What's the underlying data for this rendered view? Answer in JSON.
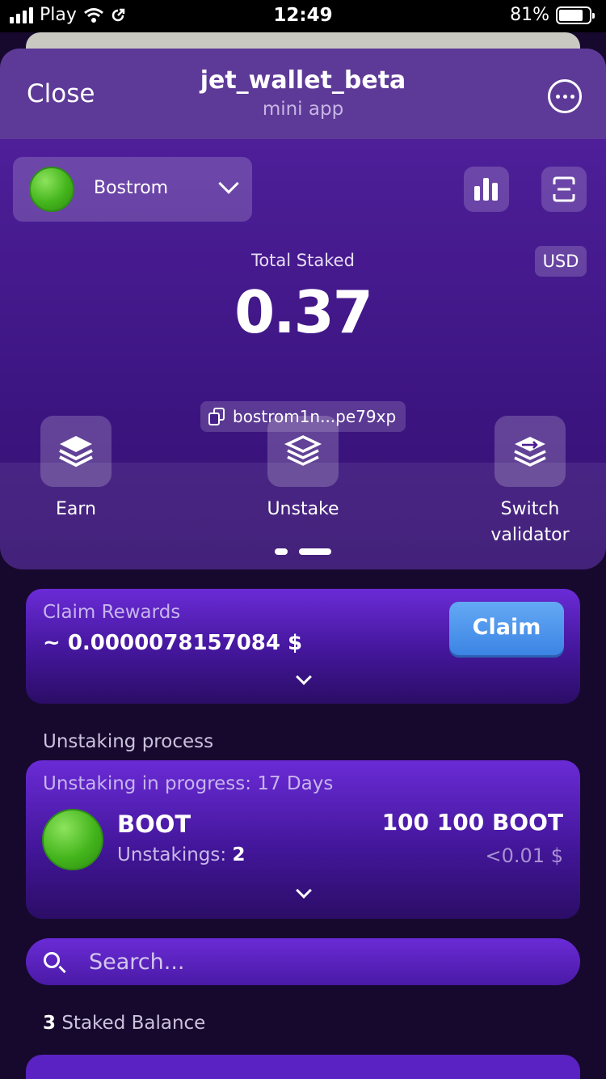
{
  "status_bar": {
    "carrier": "Play",
    "time": "12:49",
    "battery": "81%"
  },
  "header": {
    "close_label": "Close",
    "title": "jet_wallet_beta",
    "subtitle": "mini app"
  },
  "network": {
    "name": "Bostrom"
  },
  "balance": {
    "total_label": "Total Staked",
    "total_value": "0.37",
    "currency": "USD",
    "address": "bostrom1n...pe79xp"
  },
  "actions": [
    {
      "label": "Earn",
      "icon": "layers-icon"
    },
    {
      "label": "Unstake",
      "icon": "layers-outline-icon"
    },
    {
      "label": "Switch validator",
      "icon": "switch-layers-icon"
    }
  ],
  "claim": {
    "title": "Claim Rewards",
    "value": "~ 0.0000078157084 $",
    "button_label": "Claim"
  },
  "unstaking": {
    "section_label": "Unstaking process",
    "title": "Unstaking in progress: 17 Days",
    "token_name": "BOOT",
    "unstakings_label": "Unstakings:",
    "unstakings_count": "2",
    "amount": "100 100 BOOT",
    "usd_value": "<0.01 $"
  },
  "search": {
    "placeholder": "Search..."
  },
  "staked": {
    "count": "3",
    "label": "Staked Balance"
  },
  "colors": {
    "accent": "#6a2bd6",
    "button_blue": "#4a8fe8",
    "background": "#17092e"
  }
}
